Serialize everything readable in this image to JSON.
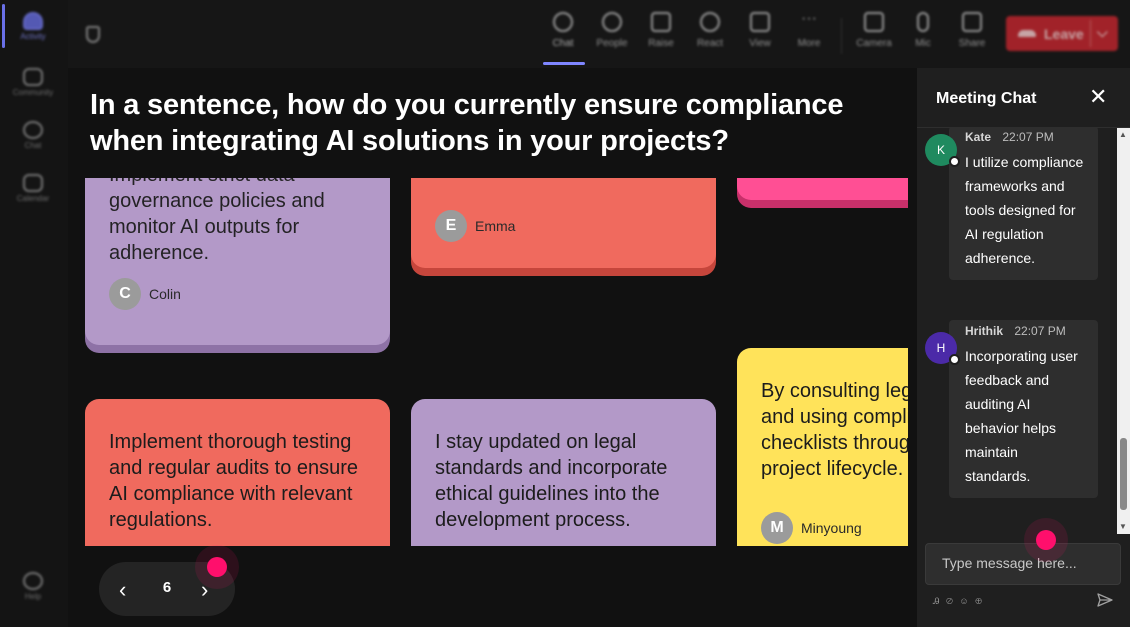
{
  "rail": {
    "items": [
      {
        "label": "Activity",
        "active": true
      },
      {
        "label": "Community",
        "active": false
      },
      {
        "label": "Chat",
        "active": false
      },
      {
        "label": "Calendar",
        "active": false
      },
      {
        "label": "Help",
        "active": false
      }
    ]
  },
  "toolbar": {
    "buttons": [
      {
        "label": "Chat",
        "icon": "chat-icon",
        "active": true
      },
      {
        "label": "People",
        "icon": "people-icon"
      },
      {
        "label": "Raise",
        "icon": "raise-hand-icon"
      },
      {
        "label": "React",
        "icon": "react-icon"
      },
      {
        "label": "View",
        "icon": "view-icon"
      },
      {
        "label": "More",
        "icon": "more-icon"
      },
      {
        "label": "Camera",
        "icon": "camera-icon"
      },
      {
        "label": "Mic",
        "icon": "mic-icon"
      },
      {
        "label": "Share",
        "icon": "share-icon"
      }
    ],
    "leave_label": "Leave",
    "accent": "#6a70e8",
    "leave_color": "#c4262e"
  },
  "question": "In a sentence, how do you currently ensure compliance when integrating AI solutions in your projects?",
  "cards": [
    {
      "text": "I implement strict data governance policies and monitor AI outputs for adherence.",
      "visible_text": "governance policies and monitor AI outputs for adherence.",
      "clipped_first_line": "Implement strict data",
      "author": "Colin",
      "initial": "C",
      "color": "#b399c8"
    },
    {
      "text": "",
      "author": "Emma",
      "initial": "E",
      "color": "#f06a5e"
    },
    {
      "text": "",
      "author": "",
      "color": "#ff4f94"
    },
    {
      "text": "Implement thorough testing and regular audits to ensure AI compliance with relevant regulations.",
      "author": "",
      "color": "#f06a5e"
    },
    {
      "text": "I stay updated on legal standards and incorporate ethical guidelines into the development process.",
      "author": "",
      "color": "#b399c8"
    },
    {
      "text": "By consulting leg and using compli checklists throug project lifecycle.",
      "author": "Minyoung",
      "initial": "M",
      "color": "#ffe35a"
    }
  ],
  "pager": {
    "prev": "‹",
    "page": "6",
    "next": "›"
  },
  "chat": {
    "title": "Meeting Chat",
    "close": "✕",
    "messages": [
      {
        "name": "Kate",
        "time": "22:07 PM",
        "initial": "K",
        "avatar_color": "#1f8a5f",
        "text": "I utilize compliance frameworks and tools designed for AI regulation adherence."
      },
      {
        "name": "Hrithik",
        "time": "22:07 PM",
        "initial": "H",
        "avatar_color": "#4b2aa8",
        "text": "Incorporating user feedback and auditing AI behavior helps maintain standards."
      }
    ],
    "placeholder": "Type message here...",
    "format_icons": "Ꭿ ⊘ ☺ ⊕"
  }
}
